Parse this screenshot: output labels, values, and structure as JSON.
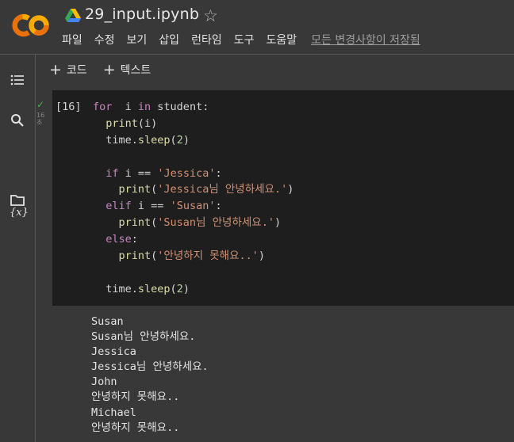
{
  "header": {
    "notebook_title": "29_input.ipynb",
    "menu": [
      "파일",
      "수정",
      "보기",
      "삽입",
      "런타임",
      "도구",
      "도움말"
    ],
    "save_status": "모든 변경사항이 저장됨"
  },
  "toolbar": {
    "add_code_label": "코드",
    "add_text_label": "텍스트"
  },
  "sidebar": {
    "icons": [
      "table-of-contents-icon",
      "search-icon",
      "variables-icon",
      "files-icon"
    ],
    "variables_label": "{x}"
  },
  "cell": {
    "exec_count": "[16]",
    "run_time": "16\n초",
    "lines": [
      {
        "indent": "",
        "tokens": [
          [
            "kw",
            "for"
          ],
          [
            "",
            "  i "
          ],
          [
            "kw",
            "in"
          ],
          [
            "",
            " student:"
          ]
        ]
      },
      {
        "indent": "  ",
        "tokens": [
          [
            "fn",
            "print"
          ],
          [
            "",
            "(i)"
          ]
        ]
      },
      {
        "indent": "  ",
        "tokens": [
          [
            "",
            "time."
          ],
          [
            "fn",
            "sleep"
          ],
          [
            "",
            "("
          ],
          [
            "num",
            "2"
          ],
          [
            "",
            ")"
          ]
        ]
      },
      {
        "indent": "",
        "tokens": []
      },
      {
        "indent": "  ",
        "tokens": [
          [
            "kw",
            "if"
          ],
          [
            "",
            " i == "
          ],
          [
            "str",
            "'Jessica'"
          ],
          [
            "",
            ":"
          ]
        ]
      },
      {
        "indent": "    ",
        "tokens": [
          [
            "fn",
            "print"
          ],
          [
            "",
            "("
          ],
          [
            "str",
            "'Jessica님 안녕하세요.'"
          ],
          [
            "",
            ")"
          ]
        ]
      },
      {
        "indent": "  ",
        "tokens": [
          [
            "kw",
            "elif"
          ],
          [
            "",
            " i == "
          ],
          [
            "str",
            "'Susan'"
          ],
          [
            "",
            ":"
          ]
        ]
      },
      {
        "indent": "    ",
        "tokens": [
          [
            "fn",
            "print"
          ],
          [
            "",
            "("
          ],
          [
            "str",
            "'Susan님 안녕하세요.'"
          ],
          [
            "",
            ")"
          ]
        ]
      },
      {
        "indent": "  ",
        "tokens": [
          [
            "kw",
            "else"
          ],
          [
            "",
            ":"
          ]
        ]
      },
      {
        "indent": "    ",
        "tokens": [
          [
            "fn",
            "print"
          ],
          [
            "",
            "("
          ],
          [
            "str",
            "'안녕하지 못해요..'"
          ],
          [
            "",
            ")"
          ]
        ]
      },
      {
        "indent": "",
        "tokens": []
      },
      {
        "indent": "  ",
        "tokens": [
          [
            "",
            "time."
          ],
          [
            "fn",
            "sleep"
          ],
          [
            "",
            "("
          ],
          [
            "num",
            "2"
          ],
          [
            "",
            ")"
          ]
        ]
      }
    ]
  },
  "output": {
    "lines": [
      "Susan",
      "Susan님 안녕하세요.",
      "Jessica",
      "Jessica님 안녕하세요.",
      "John",
      "안녕하지 못해요..",
      "Michael",
      "안녕하지 못해요.."
    ]
  },
  "colors": {
    "background": "#383838",
    "cell_background": "#1e1e1e",
    "keyword": "#c586c0",
    "function": "#dcdcaa",
    "string": "#ce9178",
    "number": "#b5cea8",
    "check": "#4caf50",
    "logo_orange": "#f9ab00",
    "logo_dark_orange": "#e8710a"
  }
}
